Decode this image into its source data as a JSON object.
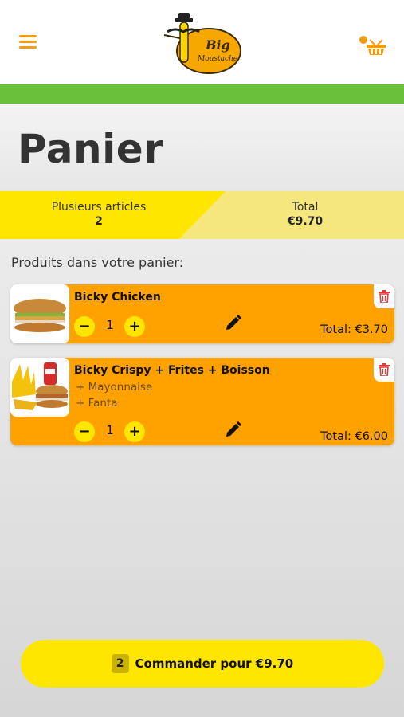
{
  "header": {
    "menu_icon": "hamburger-menu-icon",
    "logo": {
      "line1": "Big",
      "line2": "Moustache"
    },
    "cart_icon": "shopping-basket-icon"
  },
  "page": {
    "title": "Panier"
  },
  "summary": {
    "items_label": "Plusieurs articles",
    "items_value": "2",
    "total_label": "Total",
    "total_value": "€9.70"
  },
  "cart": {
    "section_label": "Produits dans votre panier:",
    "items": [
      {
        "name": "Bicky Chicken",
        "options": [],
        "quantity": "1",
        "total": "Total: €3.70",
        "minus": "−",
        "plus": "+"
      },
      {
        "name": "Bicky Crispy + Frites + Boisson",
        "options": [
          "+ Mayonnaise",
          "+ Fanta"
        ],
        "quantity": "1",
        "total": "Total: €6.00",
        "minus": "−",
        "plus": "+"
      }
    ]
  },
  "order_button": {
    "count": "2",
    "label": "Commander pour €9.70"
  },
  "colors": {
    "accent_orange": "#ffa200",
    "accent_yellow": "#ffe600",
    "green_bar": "#6abf3b",
    "trash_red": "#e53935"
  }
}
